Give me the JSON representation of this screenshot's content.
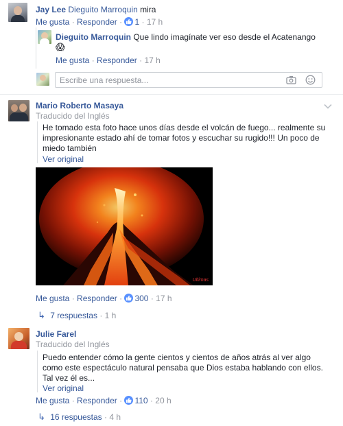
{
  "thread1": {
    "author": "Jay Lee",
    "mention": "Dieguito Marroquin",
    "text": "mira",
    "like": "Me gusta",
    "reply": "Responder",
    "likes": "1",
    "time": "17 h",
    "reply1": {
      "author": "Dieguito Marroquin",
      "text": "Que lindo imagínate ver eso desde el Acatenango",
      "emoji": "😱",
      "like": "Me gusta",
      "reply": "Responder",
      "time": "17 h"
    },
    "input_placeholder": "Escribe una respuesta..."
  },
  "comment2": {
    "author": "Mario Roberto Masaya",
    "translated": "Traducido del Inglés",
    "text_line1": "He tomado esta foto hace unos días desde el volcán de fuego... realmente su",
    "text_line2": "impresionante estado ahí de tomar fotos y escuchar su rugido!!! Un poco de",
    "text_line3": "miedo también",
    "see_original": "Ver original",
    "like": "Me gusta",
    "reply": "Responder",
    "likes": "300",
    "time": "17 h",
    "replies": "7 respuestas",
    "replies_time": "1 h",
    "photo_watermark": "Ultimas"
  },
  "comment3": {
    "author": "Julie Farel",
    "translated": "Traducido del Inglés",
    "text_line1": "Puedo entender cómo la gente cientos y cientos de años atrás al ver algo",
    "text_line2": "como este espectáculo natural pensaba que Dios estaba hablando con ellos.",
    "text_line3": "Tal vez él es...",
    "see_original": "Ver original",
    "like": "Me gusta",
    "reply": "Responder",
    "likes": "110",
    "time": "20 h",
    "replies": "16 respuestas",
    "replies_time": "4 h"
  },
  "colors": {
    "link": "#365899",
    "meta": "#90949c",
    "like_badge": "#5890ff"
  }
}
